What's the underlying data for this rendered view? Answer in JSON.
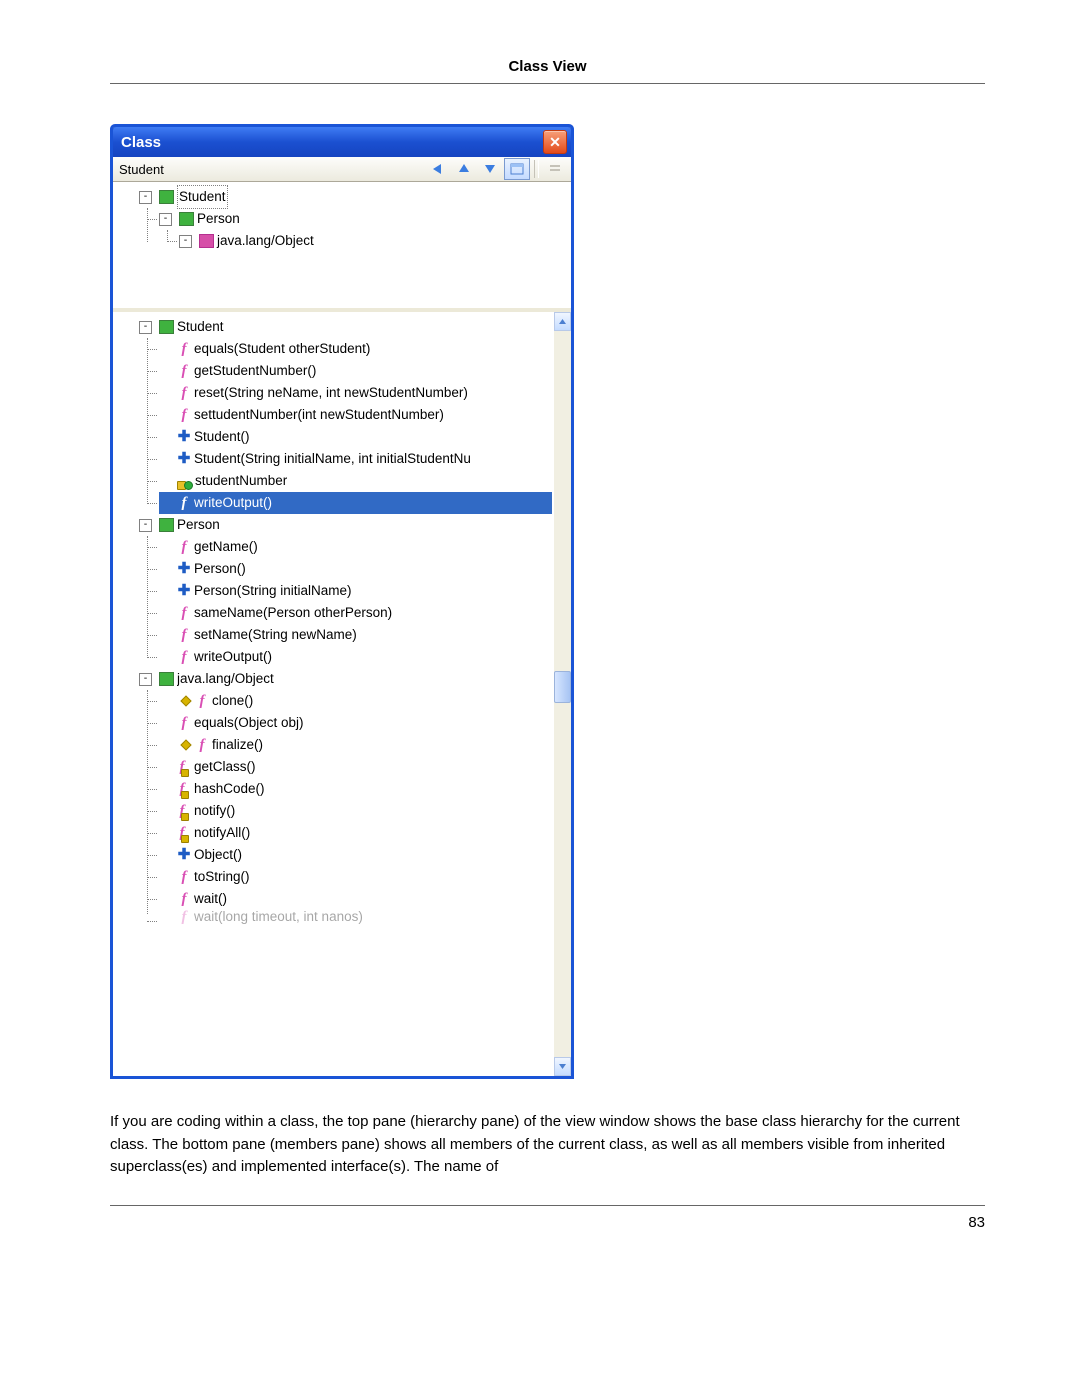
{
  "header": {
    "title": "Class View"
  },
  "window": {
    "title": "Class",
    "toolbar_text": "Student"
  },
  "hierarchy": {
    "root": {
      "label": "Student",
      "icon": "class"
    },
    "child": {
      "label": "Person",
      "icon": "class"
    },
    "grand": {
      "label": "java.lang/Object",
      "icon": "class-pink"
    }
  },
  "members": [
    {
      "kind": "class",
      "label": "Student",
      "toggle": "-",
      "children": [
        {
          "kind": "f",
          "label": "equals(Student otherStudent)"
        },
        {
          "kind": "f",
          "label": "getStudentNumber()"
        },
        {
          "kind": "f",
          "label": "reset(String neName, int newStudentNumber)"
        },
        {
          "kind": "f",
          "label": "settudentNumber(int newStudentNumber)"
        },
        {
          "kind": "plus",
          "label": "Student()"
        },
        {
          "kind": "plus",
          "label": "Student(String initialName, int initialStudentNu"
        },
        {
          "kind": "field",
          "label": "studentNumber"
        },
        {
          "kind": "f",
          "label": "writeOutput()",
          "selected": true
        }
      ]
    },
    {
      "kind": "class",
      "label": "Person",
      "toggle": "-",
      "children": [
        {
          "kind": "f",
          "label": "getName()"
        },
        {
          "kind": "plus",
          "label": "Person()"
        },
        {
          "kind": "plus",
          "label": "Person(String initialName)"
        },
        {
          "kind": "f",
          "label": "sameName(Person otherPerson)"
        },
        {
          "kind": "f",
          "label": "setName(String newName)"
        },
        {
          "kind": "f",
          "label": "writeOutput()"
        }
      ]
    },
    {
      "kind": "class",
      "label": "java.lang/Object",
      "toggle": "-",
      "children": [
        {
          "kind": "f-key",
          "label": "clone()"
        },
        {
          "kind": "f",
          "label": "equals(Object obj)"
        },
        {
          "kind": "f-key",
          "label": "finalize()"
        },
        {
          "kind": "f-lock",
          "label": "getClass()"
        },
        {
          "kind": "f-lock",
          "label": "hashCode()"
        },
        {
          "kind": "f-lock",
          "label": "notify()"
        },
        {
          "kind": "f-lock",
          "label": "notifyAll()"
        },
        {
          "kind": "plus",
          "label": "Object()"
        },
        {
          "kind": "f",
          "label": "toString()"
        },
        {
          "kind": "f",
          "label": "wait()"
        },
        {
          "kind": "f-cut",
          "label": "wait(long timeout, int nanos)"
        }
      ]
    }
  ],
  "paragraph": "If you are coding within a class, the top pane (hierarchy pane) of the view window shows the base class hierarchy for the current class. The bottom pane (members pane) shows all members of the current class, as well as all members visible from inherited superclass(es) and implemented interface(s). The name of",
  "page_number": "83"
}
